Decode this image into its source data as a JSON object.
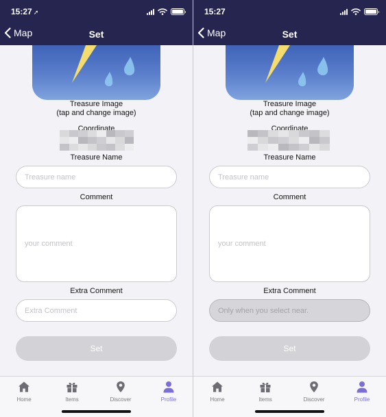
{
  "colors": {
    "nav_bar": "#252550",
    "screen_bg": "#f2f2f7",
    "accent": "#7b6fd6",
    "image_blue": "#4a6fc2",
    "lightning": "#f5dc6e",
    "drop": "#8ec8f0"
  },
  "screens": [
    {
      "status": {
        "time": "15:27",
        "location_arrow": "➚"
      },
      "nav": {
        "back_label": "Map",
        "title": "Set",
        "back_icon": "chevron-left-icon"
      },
      "treasure_image": {
        "caption_line1": "Treasure Image",
        "caption_line2": "(tap and change image)"
      },
      "coordinate": {
        "label": "Coordinate"
      },
      "treasure_name": {
        "label": "Treasure Name",
        "placeholder": "Treasure name"
      },
      "comment": {
        "label": "Comment",
        "placeholder": "your comment"
      },
      "extra_comment": {
        "label": "Extra Comment",
        "placeholder": "Extra Comment",
        "disabled": false
      },
      "set_button": {
        "label": "Set"
      }
    },
    {
      "status": {
        "time": "15:27",
        "location_arrow": ""
      },
      "nav": {
        "back_label": "Map",
        "title": "Set",
        "back_icon": "chevron-left-icon"
      },
      "treasure_image": {
        "caption_line1": "Treasure Image",
        "caption_line2": "(tap and change image)"
      },
      "coordinate": {
        "label": "Coordinate"
      },
      "treasure_name": {
        "label": "Treasure Name",
        "placeholder": "Treasure name"
      },
      "comment": {
        "label": "Comment",
        "placeholder": "your comment"
      },
      "extra_comment": {
        "label": "Extra Comment",
        "placeholder": "Only when you select near.",
        "disabled": true
      },
      "set_button": {
        "label": "Set"
      }
    }
  ],
  "tabbar": {
    "items": [
      {
        "label": "Home",
        "icon": "home-icon",
        "active": false
      },
      {
        "label": "Items",
        "icon": "gift-icon",
        "active": false
      },
      {
        "label": "Discover",
        "icon": "map-pin-icon",
        "active": false
      },
      {
        "label": "Profile",
        "icon": "person-icon",
        "active": true
      }
    ]
  }
}
